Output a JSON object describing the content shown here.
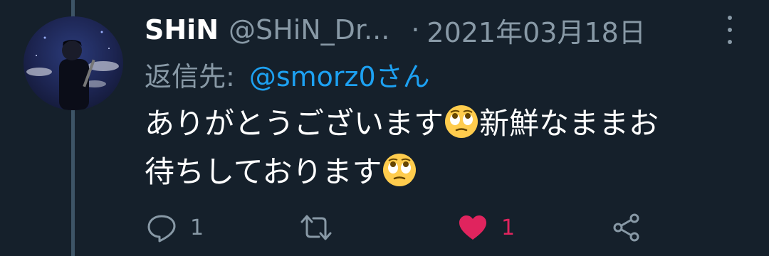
{
  "tweet": {
    "display_name": "SHiN",
    "handle": "@SHiN_Dr...",
    "separator": "·",
    "date": "2021年03月18日",
    "reply_label": "返信先:",
    "reply_to": "@smorz0さん",
    "body": {
      "line1_a": "ありがとうございます",
      "line1_b": "新鮮なままお",
      "line2": "待ちしております",
      "emoji": "face-with-rolling-eyes"
    }
  },
  "actions": {
    "reply_count": "1",
    "retweet_count": "",
    "like_count": "1",
    "liked": true
  },
  "colors": {
    "background": "#15202b",
    "muted": "#8899a6",
    "link": "#1da1f2",
    "like": "#e0245e",
    "thread_line": "#3d5466"
  }
}
